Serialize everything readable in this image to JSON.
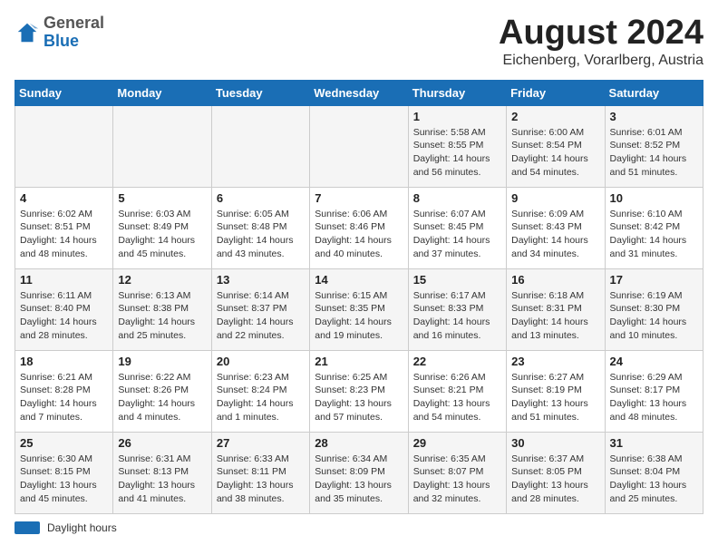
{
  "header": {
    "logo_general": "General",
    "logo_blue": "Blue",
    "month_year": "August 2024",
    "location": "Eichenberg, Vorarlberg, Austria"
  },
  "days_of_week": [
    "Sunday",
    "Monday",
    "Tuesday",
    "Wednesday",
    "Thursday",
    "Friday",
    "Saturday"
  ],
  "weeks": [
    [
      {
        "day": "",
        "info": ""
      },
      {
        "day": "",
        "info": ""
      },
      {
        "day": "",
        "info": ""
      },
      {
        "day": "",
        "info": ""
      },
      {
        "day": "1",
        "info": "Sunrise: 5:58 AM\nSunset: 8:55 PM\nDaylight: 14 hours and 56 minutes."
      },
      {
        "day": "2",
        "info": "Sunrise: 6:00 AM\nSunset: 8:54 PM\nDaylight: 14 hours and 54 minutes."
      },
      {
        "day": "3",
        "info": "Sunrise: 6:01 AM\nSunset: 8:52 PM\nDaylight: 14 hours and 51 minutes."
      }
    ],
    [
      {
        "day": "4",
        "info": "Sunrise: 6:02 AM\nSunset: 8:51 PM\nDaylight: 14 hours and 48 minutes."
      },
      {
        "day": "5",
        "info": "Sunrise: 6:03 AM\nSunset: 8:49 PM\nDaylight: 14 hours and 45 minutes."
      },
      {
        "day": "6",
        "info": "Sunrise: 6:05 AM\nSunset: 8:48 PM\nDaylight: 14 hours and 43 minutes."
      },
      {
        "day": "7",
        "info": "Sunrise: 6:06 AM\nSunset: 8:46 PM\nDaylight: 14 hours and 40 minutes."
      },
      {
        "day": "8",
        "info": "Sunrise: 6:07 AM\nSunset: 8:45 PM\nDaylight: 14 hours and 37 minutes."
      },
      {
        "day": "9",
        "info": "Sunrise: 6:09 AM\nSunset: 8:43 PM\nDaylight: 14 hours and 34 minutes."
      },
      {
        "day": "10",
        "info": "Sunrise: 6:10 AM\nSunset: 8:42 PM\nDaylight: 14 hours and 31 minutes."
      }
    ],
    [
      {
        "day": "11",
        "info": "Sunrise: 6:11 AM\nSunset: 8:40 PM\nDaylight: 14 hours and 28 minutes."
      },
      {
        "day": "12",
        "info": "Sunrise: 6:13 AM\nSunset: 8:38 PM\nDaylight: 14 hours and 25 minutes."
      },
      {
        "day": "13",
        "info": "Sunrise: 6:14 AM\nSunset: 8:37 PM\nDaylight: 14 hours and 22 minutes."
      },
      {
        "day": "14",
        "info": "Sunrise: 6:15 AM\nSunset: 8:35 PM\nDaylight: 14 hours and 19 minutes."
      },
      {
        "day": "15",
        "info": "Sunrise: 6:17 AM\nSunset: 8:33 PM\nDaylight: 14 hours and 16 minutes."
      },
      {
        "day": "16",
        "info": "Sunrise: 6:18 AM\nSunset: 8:31 PM\nDaylight: 14 hours and 13 minutes."
      },
      {
        "day": "17",
        "info": "Sunrise: 6:19 AM\nSunset: 8:30 PM\nDaylight: 14 hours and 10 minutes."
      }
    ],
    [
      {
        "day": "18",
        "info": "Sunrise: 6:21 AM\nSunset: 8:28 PM\nDaylight: 14 hours and 7 minutes."
      },
      {
        "day": "19",
        "info": "Sunrise: 6:22 AM\nSunset: 8:26 PM\nDaylight: 14 hours and 4 minutes."
      },
      {
        "day": "20",
        "info": "Sunrise: 6:23 AM\nSunset: 8:24 PM\nDaylight: 14 hours and 1 minutes."
      },
      {
        "day": "21",
        "info": "Sunrise: 6:25 AM\nSunset: 8:23 PM\nDaylight: 13 hours and 57 minutes."
      },
      {
        "day": "22",
        "info": "Sunrise: 6:26 AM\nSunset: 8:21 PM\nDaylight: 13 hours and 54 minutes."
      },
      {
        "day": "23",
        "info": "Sunrise: 6:27 AM\nSunset: 8:19 PM\nDaylight: 13 hours and 51 minutes."
      },
      {
        "day": "24",
        "info": "Sunrise: 6:29 AM\nSunset: 8:17 PM\nDaylight: 13 hours and 48 minutes."
      }
    ],
    [
      {
        "day": "25",
        "info": "Sunrise: 6:30 AM\nSunset: 8:15 PM\nDaylight: 13 hours and 45 minutes."
      },
      {
        "day": "26",
        "info": "Sunrise: 6:31 AM\nSunset: 8:13 PM\nDaylight: 13 hours and 41 minutes."
      },
      {
        "day": "27",
        "info": "Sunrise: 6:33 AM\nSunset: 8:11 PM\nDaylight: 13 hours and 38 minutes."
      },
      {
        "day": "28",
        "info": "Sunrise: 6:34 AM\nSunset: 8:09 PM\nDaylight: 13 hours and 35 minutes."
      },
      {
        "day": "29",
        "info": "Sunrise: 6:35 AM\nSunset: 8:07 PM\nDaylight: 13 hours and 32 minutes."
      },
      {
        "day": "30",
        "info": "Sunrise: 6:37 AM\nSunset: 8:05 PM\nDaylight: 13 hours and 28 minutes."
      },
      {
        "day": "31",
        "info": "Sunrise: 6:38 AM\nSunset: 8:04 PM\nDaylight: 13 hours and 25 minutes."
      }
    ]
  ],
  "legend": {
    "label": "Daylight hours"
  }
}
